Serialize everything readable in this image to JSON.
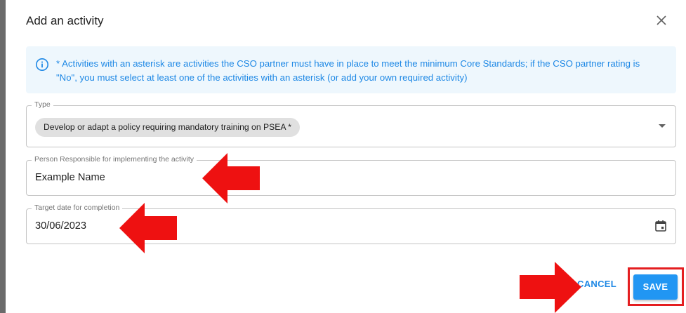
{
  "dialog": {
    "title": "Add an activity",
    "close_icon": "close-icon"
  },
  "info": {
    "icon": "info-icon",
    "text": "* Activities with an asterisk are activities the CSO partner must have in place to meet the minimum Core Standards; if the CSO partner rating is \"No\", you must select at least one of the activities with an asterisk (or add your own required activity)"
  },
  "type_field": {
    "label": "Type",
    "selected_chip": "Develop or adapt a policy requiring mandatory training on PSEA *",
    "icon": "dropdown-arrow-icon"
  },
  "person_field": {
    "label": "Person Responsible for implementing the activity",
    "value": "Example Name"
  },
  "date_field": {
    "label": "Target date for completion",
    "value": "30/06/2023",
    "icon": "calendar-icon"
  },
  "actions": {
    "cancel_label": "CANCEL",
    "save_label": "SAVE"
  },
  "colors": {
    "accent": "#2196f3",
    "info_bg": "#eef7fd",
    "info_text": "#1e88e5",
    "annotation_red": "#e41e20"
  }
}
